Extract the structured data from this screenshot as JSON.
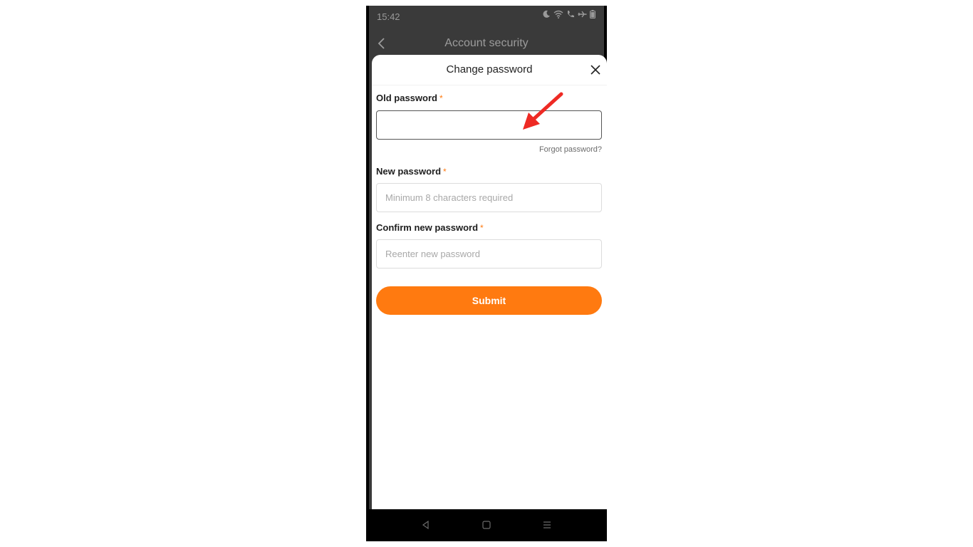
{
  "status_bar": {
    "time": "15:42",
    "icons": [
      "moon-icon",
      "wifi-icon",
      "call-icon",
      "airplane-icon",
      "battery-icon"
    ]
  },
  "app_header": {
    "title": "Account security",
    "back_icon": "chevron-left-icon"
  },
  "dialog": {
    "title": "Change password",
    "close_icon": "close-icon",
    "fields": {
      "old_password": {
        "label": "Old password",
        "required_mark": "*",
        "value": "",
        "placeholder": ""
      },
      "new_password": {
        "label": "New password",
        "required_mark": "*",
        "value": "",
        "placeholder": "Minimum 8 characters required"
      },
      "confirm_password": {
        "label": "Confirm new password",
        "required_mark": "*",
        "value": "",
        "placeholder": "Reenter new password"
      }
    },
    "forgot_link": "Forgot password?",
    "submit_label": "Submit"
  },
  "nav_bar": {
    "buttons": [
      "back-triangle-icon",
      "home-square-icon",
      "menu-lines-icon"
    ]
  },
  "colors": {
    "accent": "#ff7a10",
    "annotation_arrow": "#ee2a24",
    "overlay": "#3a3a3a"
  }
}
